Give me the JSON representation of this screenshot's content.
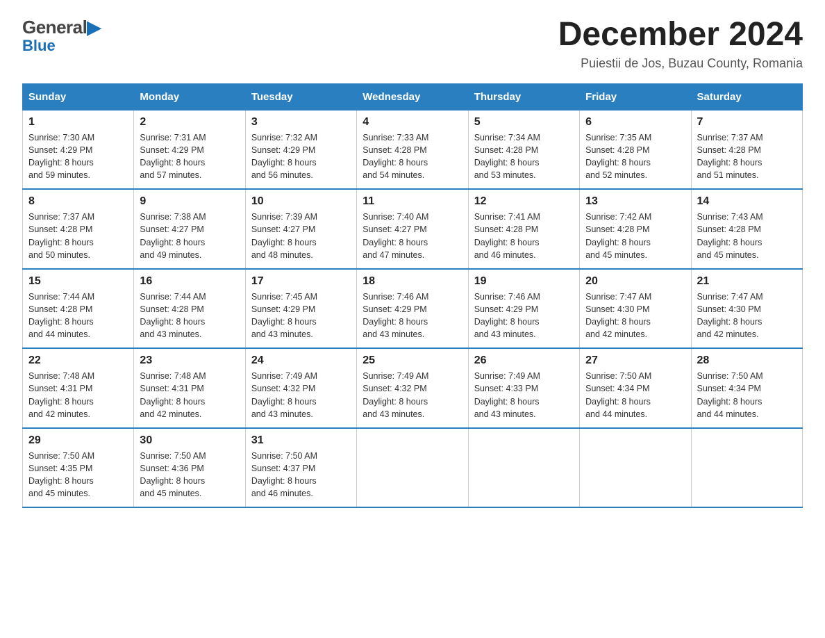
{
  "header": {
    "logo_line1": "General",
    "logo_line2": "Blue",
    "month_title": "December 2024",
    "location": "Puiestii de Jos, Buzau County, Romania"
  },
  "columns": [
    "Sunday",
    "Monday",
    "Tuesday",
    "Wednesday",
    "Thursday",
    "Friday",
    "Saturday"
  ],
  "weeks": [
    [
      {
        "day": "1",
        "sunrise": "7:30 AM",
        "sunset": "4:29 PM",
        "daylight": "8 hours and 59 minutes."
      },
      {
        "day": "2",
        "sunrise": "7:31 AM",
        "sunset": "4:29 PM",
        "daylight": "8 hours and 57 minutes."
      },
      {
        "day": "3",
        "sunrise": "7:32 AM",
        "sunset": "4:29 PM",
        "daylight": "8 hours and 56 minutes."
      },
      {
        "day": "4",
        "sunrise": "7:33 AM",
        "sunset": "4:28 PM",
        "daylight": "8 hours and 54 minutes."
      },
      {
        "day": "5",
        "sunrise": "7:34 AM",
        "sunset": "4:28 PM",
        "daylight": "8 hours and 53 minutes."
      },
      {
        "day": "6",
        "sunrise": "7:35 AM",
        "sunset": "4:28 PM",
        "daylight": "8 hours and 52 minutes."
      },
      {
        "day": "7",
        "sunrise": "7:37 AM",
        "sunset": "4:28 PM",
        "daylight": "8 hours and 51 minutes."
      }
    ],
    [
      {
        "day": "8",
        "sunrise": "7:37 AM",
        "sunset": "4:28 PM",
        "daylight": "8 hours and 50 minutes."
      },
      {
        "day": "9",
        "sunrise": "7:38 AM",
        "sunset": "4:27 PM",
        "daylight": "8 hours and 49 minutes."
      },
      {
        "day": "10",
        "sunrise": "7:39 AM",
        "sunset": "4:27 PM",
        "daylight": "8 hours and 48 minutes."
      },
      {
        "day": "11",
        "sunrise": "7:40 AM",
        "sunset": "4:27 PM",
        "daylight": "8 hours and 47 minutes."
      },
      {
        "day": "12",
        "sunrise": "7:41 AM",
        "sunset": "4:28 PM",
        "daylight": "8 hours and 46 minutes."
      },
      {
        "day": "13",
        "sunrise": "7:42 AM",
        "sunset": "4:28 PM",
        "daylight": "8 hours and 45 minutes."
      },
      {
        "day": "14",
        "sunrise": "7:43 AM",
        "sunset": "4:28 PM",
        "daylight": "8 hours and 45 minutes."
      }
    ],
    [
      {
        "day": "15",
        "sunrise": "7:44 AM",
        "sunset": "4:28 PM",
        "daylight": "8 hours and 44 minutes."
      },
      {
        "day": "16",
        "sunrise": "7:44 AM",
        "sunset": "4:28 PM",
        "daylight": "8 hours and 43 minutes."
      },
      {
        "day": "17",
        "sunrise": "7:45 AM",
        "sunset": "4:29 PM",
        "daylight": "8 hours and 43 minutes."
      },
      {
        "day": "18",
        "sunrise": "7:46 AM",
        "sunset": "4:29 PM",
        "daylight": "8 hours and 43 minutes."
      },
      {
        "day": "19",
        "sunrise": "7:46 AM",
        "sunset": "4:29 PM",
        "daylight": "8 hours and 43 minutes."
      },
      {
        "day": "20",
        "sunrise": "7:47 AM",
        "sunset": "4:30 PM",
        "daylight": "8 hours and 42 minutes."
      },
      {
        "day": "21",
        "sunrise": "7:47 AM",
        "sunset": "4:30 PM",
        "daylight": "8 hours and 42 minutes."
      }
    ],
    [
      {
        "day": "22",
        "sunrise": "7:48 AM",
        "sunset": "4:31 PM",
        "daylight": "8 hours and 42 minutes."
      },
      {
        "day": "23",
        "sunrise": "7:48 AM",
        "sunset": "4:31 PM",
        "daylight": "8 hours and 42 minutes."
      },
      {
        "day": "24",
        "sunrise": "7:49 AM",
        "sunset": "4:32 PM",
        "daylight": "8 hours and 43 minutes."
      },
      {
        "day": "25",
        "sunrise": "7:49 AM",
        "sunset": "4:32 PM",
        "daylight": "8 hours and 43 minutes."
      },
      {
        "day": "26",
        "sunrise": "7:49 AM",
        "sunset": "4:33 PM",
        "daylight": "8 hours and 43 minutes."
      },
      {
        "day": "27",
        "sunrise": "7:50 AM",
        "sunset": "4:34 PM",
        "daylight": "8 hours and 44 minutes."
      },
      {
        "day": "28",
        "sunrise": "7:50 AM",
        "sunset": "4:34 PM",
        "daylight": "8 hours and 44 minutes."
      }
    ],
    [
      {
        "day": "29",
        "sunrise": "7:50 AM",
        "sunset": "4:35 PM",
        "daylight": "8 hours and 45 minutes."
      },
      {
        "day": "30",
        "sunrise": "7:50 AM",
        "sunset": "4:36 PM",
        "daylight": "8 hours and 45 minutes."
      },
      {
        "day": "31",
        "sunrise": "7:50 AM",
        "sunset": "4:37 PM",
        "daylight": "8 hours and 46 minutes."
      },
      null,
      null,
      null,
      null
    ]
  ],
  "labels": {
    "sunrise_prefix": "Sunrise: ",
    "sunset_prefix": "Sunset: ",
    "daylight_prefix": "Daylight: "
  }
}
